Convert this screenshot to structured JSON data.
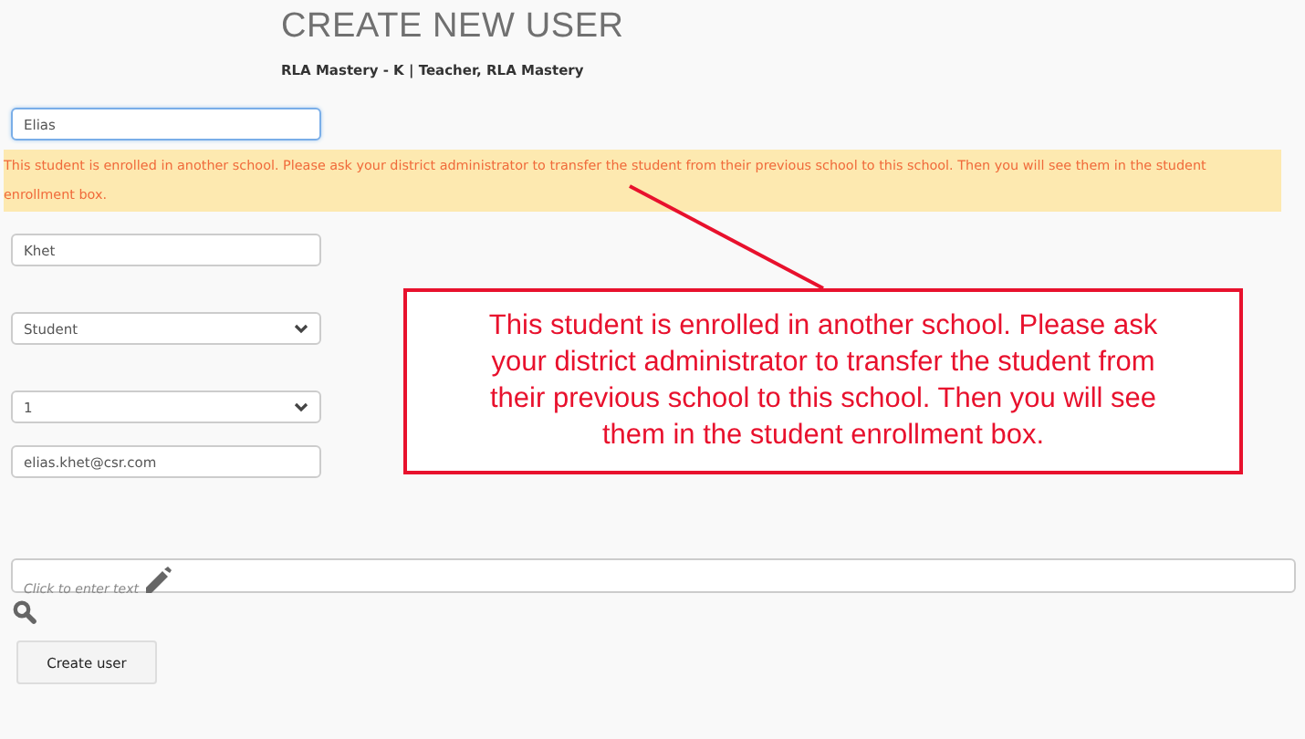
{
  "header": {
    "title": "CREATE NEW USER",
    "subtitle": "RLA Mastery - K | Teacher, RLA Mastery"
  },
  "fields": [
    {
      "kind": "text",
      "value": "Elias",
      "focused": true
    },
    {
      "kind": "warning",
      "text": "This student is enrolled in another school. Please ask your district administrator to transfer the student from their previous school to this school. Then you will see them in the student enrollment box."
    },
    {
      "kind": "text",
      "value": "Khet",
      "focused": false
    },
    {
      "kind": "select",
      "value": "Student"
    },
    {
      "kind": "select",
      "value": "1"
    },
    {
      "kind": "text",
      "value": "elias.khet@csr.com",
      "focused": false
    }
  ],
  "editor": {
    "placeholder": "Click to enter text"
  },
  "button": "Create user",
  "callout": {
    "text": "This student is enrolled in another school. Please ask your district administrator to transfer the student from their previous school to this school. Then you will see them in the student enrollment box."
  }
}
